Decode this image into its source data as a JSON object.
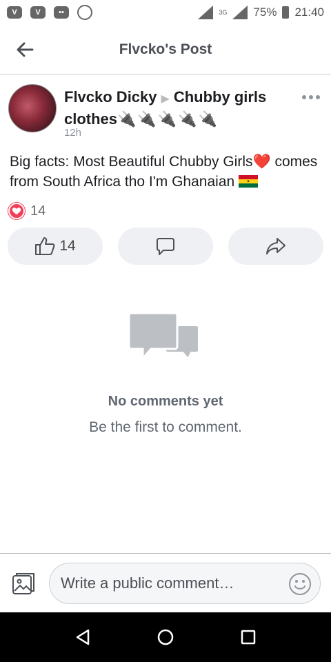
{
  "status_bar": {
    "network": "3G",
    "battery": "75%",
    "time": "21:40",
    "icons": [
      "vimeo-icon",
      "vimeo-icon",
      "gamepad-icon",
      "whatsapp-icon",
      "signal-icon",
      "signal-icon",
      "battery-icon"
    ]
  },
  "header": {
    "title": "Flvcko's Post",
    "back_icon": "arrow-left-icon"
  },
  "post": {
    "author": "Flvcko Dicky",
    "target_group": "Chubby girls clothes",
    "target_emoji": "🔌🔌🔌🔌🔌",
    "time": "12h",
    "text": "Big facts: Most Beautiful Chubby Girls❤️ comes from South Africa tho I'm Ghanaian",
    "flag_name": "ghana-flag",
    "reaction_count": "14",
    "like_count": "14",
    "reaction_type": "love",
    "colors": {
      "love": "#f33e58",
      "button_bg": "#eff0f3"
    }
  },
  "empty_state": {
    "title": "No comments yet",
    "subtitle": "Be the first to comment."
  },
  "comment_bar": {
    "placeholder": "Write a public comment…"
  }
}
